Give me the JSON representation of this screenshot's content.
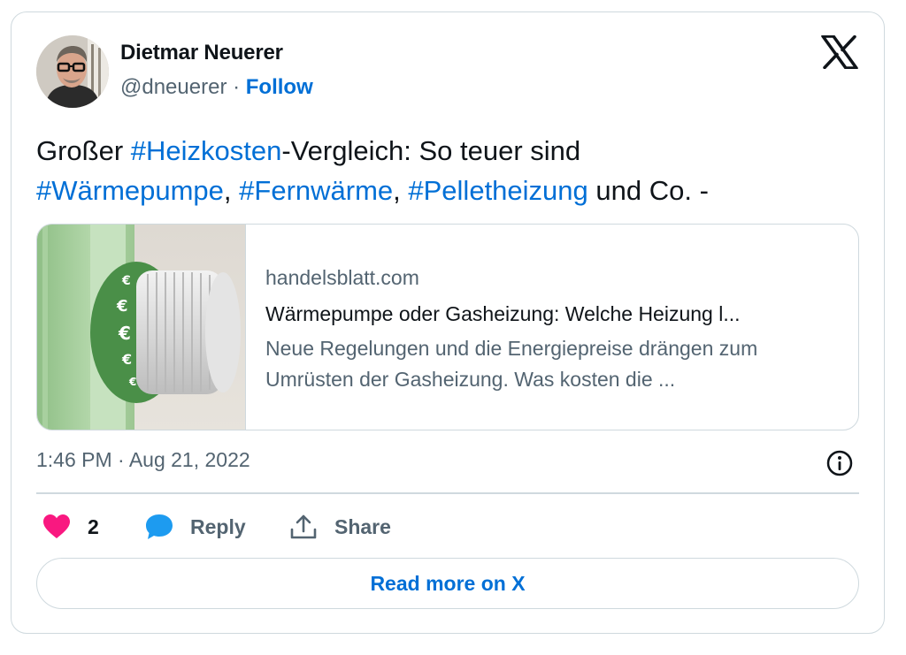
{
  "author": {
    "name": "Dietmar Neuerer",
    "handle": "@dneuerer",
    "separator": " · ",
    "follow_label": "Follow"
  },
  "tweet": {
    "parts": [
      {
        "text": "Großer ",
        "hashtag": false
      },
      {
        "text": "#Heizkosten",
        "hashtag": true
      },
      {
        "text": "-Vergleich: So teuer sind ",
        "hashtag": false
      },
      {
        "text": "#Wärmepumpe",
        "hashtag": true
      },
      {
        "text": ", ",
        "hashtag": false
      },
      {
        "text": "#Fernwärme",
        "hashtag": true
      },
      {
        "text": ", ",
        "hashtag": false
      },
      {
        "text": "#Pelletheizung",
        "hashtag": true
      },
      {
        "text": " und Co. -",
        "hashtag": false
      }
    ]
  },
  "link_card": {
    "domain": "handelsblatt.com",
    "title": "Wärmepumpe oder Gasheizung: Welche Heizung l...",
    "description": "Neue Regelungen und die Energiepreise drängen zum Umrüsten der Gasheizung. Was kosten die ..."
  },
  "timestamp": "1:46 PM · Aug 21, 2022",
  "actions": {
    "like_count": "2",
    "reply_label": "Reply",
    "share_label": "Share"
  },
  "read_more_label": "Read more on X",
  "icons": {
    "logo": "x-logo-icon",
    "info": "info-icon",
    "like": "heart-icon",
    "reply": "speech-bubble-icon",
    "share": "share-upload-icon"
  },
  "colors": {
    "link_blue": "#006fd6",
    "heart_red": "#f91880",
    "reply_blue": "#1d9bf0",
    "secondary_text": "#536471",
    "border": "#cfd9de"
  }
}
